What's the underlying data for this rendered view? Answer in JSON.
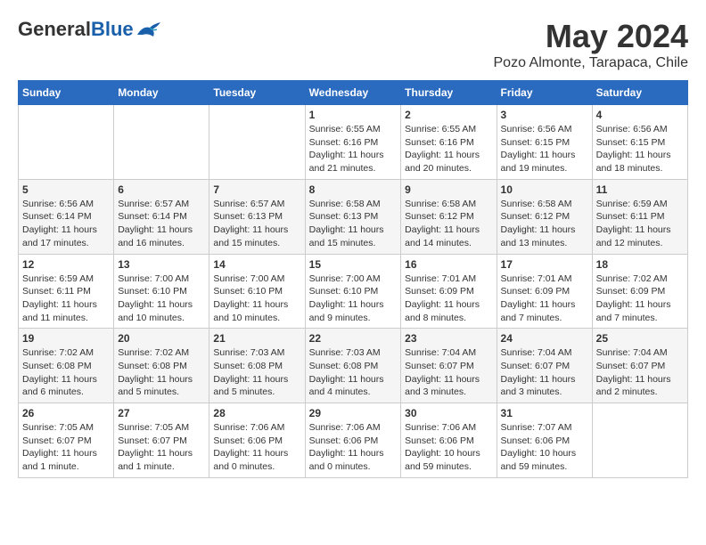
{
  "header": {
    "logo_general": "General",
    "logo_blue": "Blue",
    "title": "May 2024",
    "subtitle": "Pozo Almonte, Tarapaca, Chile"
  },
  "weekdays": [
    "Sunday",
    "Monday",
    "Tuesday",
    "Wednesday",
    "Thursday",
    "Friday",
    "Saturday"
  ],
  "weeks": [
    [
      {
        "day": "",
        "content": ""
      },
      {
        "day": "",
        "content": ""
      },
      {
        "day": "",
        "content": ""
      },
      {
        "day": "1",
        "content": "Sunrise: 6:55 AM\nSunset: 6:16 PM\nDaylight: 11 hours and 21 minutes."
      },
      {
        "day": "2",
        "content": "Sunrise: 6:55 AM\nSunset: 6:16 PM\nDaylight: 11 hours and 20 minutes."
      },
      {
        "day": "3",
        "content": "Sunrise: 6:56 AM\nSunset: 6:15 PM\nDaylight: 11 hours and 19 minutes."
      },
      {
        "day": "4",
        "content": "Sunrise: 6:56 AM\nSunset: 6:15 PM\nDaylight: 11 hours and 18 minutes."
      }
    ],
    [
      {
        "day": "5",
        "content": "Sunrise: 6:56 AM\nSunset: 6:14 PM\nDaylight: 11 hours and 17 minutes."
      },
      {
        "day": "6",
        "content": "Sunrise: 6:57 AM\nSunset: 6:14 PM\nDaylight: 11 hours and 16 minutes."
      },
      {
        "day": "7",
        "content": "Sunrise: 6:57 AM\nSunset: 6:13 PM\nDaylight: 11 hours and 15 minutes."
      },
      {
        "day": "8",
        "content": "Sunrise: 6:58 AM\nSunset: 6:13 PM\nDaylight: 11 hours and 15 minutes."
      },
      {
        "day": "9",
        "content": "Sunrise: 6:58 AM\nSunset: 6:12 PM\nDaylight: 11 hours and 14 minutes."
      },
      {
        "day": "10",
        "content": "Sunrise: 6:58 AM\nSunset: 6:12 PM\nDaylight: 11 hours and 13 minutes."
      },
      {
        "day": "11",
        "content": "Sunrise: 6:59 AM\nSunset: 6:11 PM\nDaylight: 11 hours and 12 minutes."
      }
    ],
    [
      {
        "day": "12",
        "content": "Sunrise: 6:59 AM\nSunset: 6:11 PM\nDaylight: 11 hours and 11 minutes."
      },
      {
        "day": "13",
        "content": "Sunrise: 7:00 AM\nSunset: 6:10 PM\nDaylight: 11 hours and 10 minutes."
      },
      {
        "day": "14",
        "content": "Sunrise: 7:00 AM\nSunset: 6:10 PM\nDaylight: 11 hours and 10 minutes."
      },
      {
        "day": "15",
        "content": "Sunrise: 7:00 AM\nSunset: 6:10 PM\nDaylight: 11 hours and 9 minutes."
      },
      {
        "day": "16",
        "content": "Sunrise: 7:01 AM\nSunset: 6:09 PM\nDaylight: 11 hours and 8 minutes."
      },
      {
        "day": "17",
        "content": "Sunrise: 7:01 AM\nSunset: 6:09 PM\nDaylight: 11 hours and 7 minutes."
      },
      {
        "day": "18",
        "content": "Sunrise: 7:02 AM\nSunset: 6:09 PM\nDaylight: 11 hours and 7 minutes."
      }
    ],
    [
      {
        "day": "19",
        "content": "Sunrise: 7:02 AM\nSunset: 6:08 PM\nDaylight: 11 hours and 6 minutes."
      },
      {
        "day": "20",
        "content": "Sunrise: 7:02 AM\nSunset: 6:08 PM\nDaylight: 11 hours and 5 minutes."
      },
      {
        "day": "21",
        "content": "Sunrise: 7:03 AM\nSunset: 6:08 PM\nDaylight: 11 hours and 5 minutes."
      },
      {
        "day": "22",
        "content": "Sunrise: 7:03 AM\nSunset: 6:08 PM\nDaylight: 11 hours and 4 minutes."
      },
      {
        "day": "23",
        "content": "Sunrise: 7:04 AM\nSunset: 6:07 PM\nDaylight: 11 hours and 3 minutes."
      },
      {
        "day": "24",
        "content": "Sunrise: 7:04 AM\nSunset: 6:07 PM\nDaylight: 11 hours and 3 minutes."
      },
      {
        "day": "25",
        "content": "Sunrise: 7:04 AM\nSunset: 6:07 PM\nDaylight: 11 hours and 2 minutes."
      }
    ],
    [
      {
        "day": "26",
        "content": "Sunrise: 7:05 AM\nSunset: 6:07 PM\nDaylight: 11 hours and 1 minute."
      },
      {
        "day": "27",
        "content": "Sunrise: 7:05 AM\nSunset: 6:07 PM\nDaylight: 11 hours and 1 minute."
      },
      {
        "day": "28",
        "content": "Sunrise: 7:06 AM\nSunset: 6:06 PM\nDaylight: 11 hours and 0 minutes."
      },
      {
        "day": "29",
        "content": "Sunrise: 7:06 AM\nSunset: 6:06 PM\nDaylight: 11 hours and 0 minutes."
      },
      {
        "day": "30",
        "content": "Sunrise: 7:06 AM\nSunset: 6:06 PM\nDaylight: 10 hours and 59 minutes."
      },
      {
        "day": "31",
        "content": "Sunrise: 7:07 AM\nSunset: 6:06 PM\nDaylight: 10 hours and 59 minutes."
      },
      {
        "day": "",
        "content": ""
      }
    ]
  ]
}
